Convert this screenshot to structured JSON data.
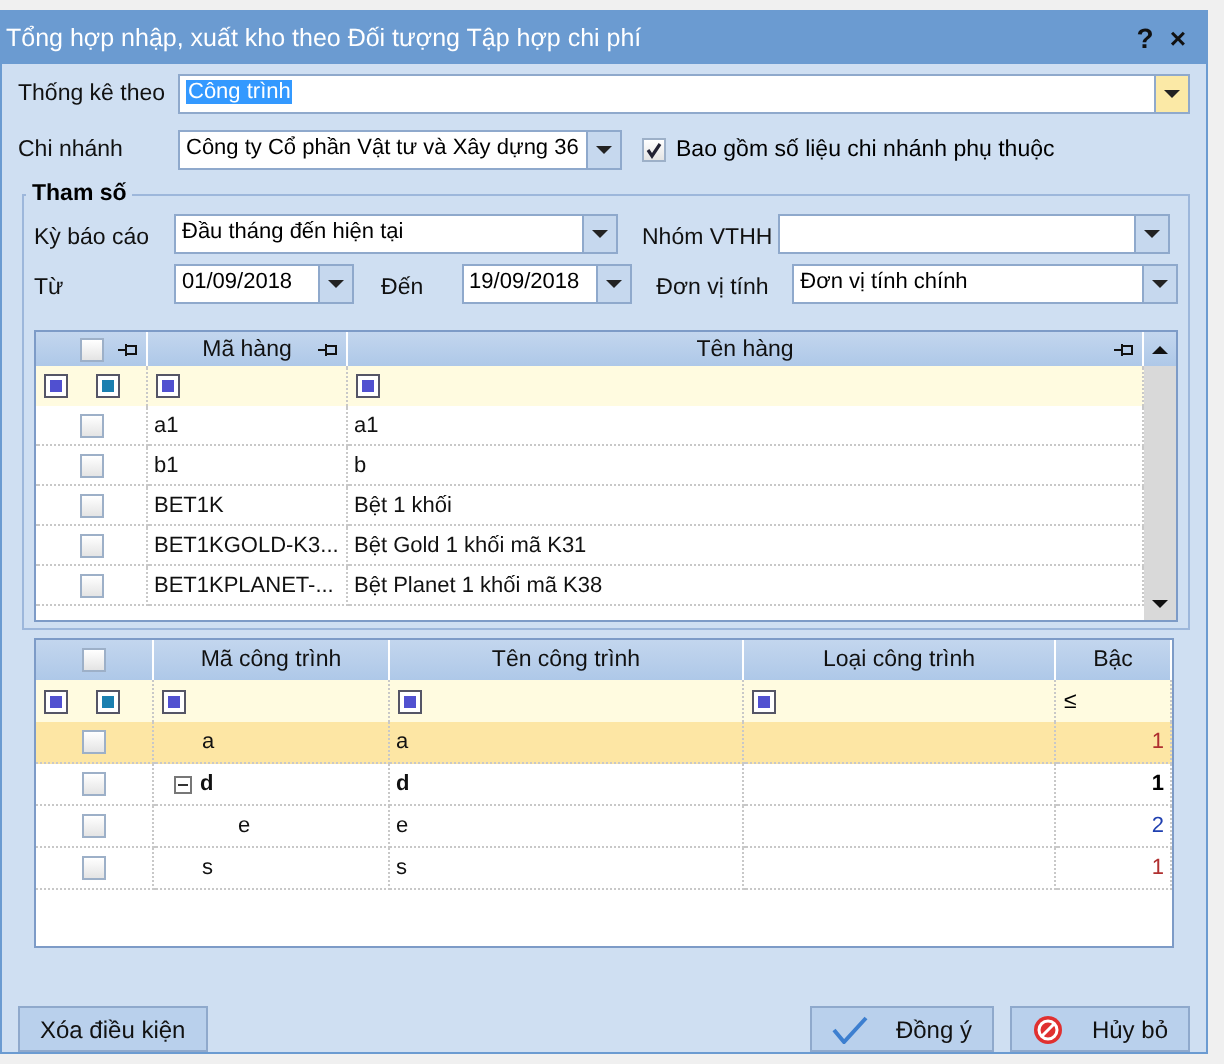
{
  "window": {
    "title": "Tổng hợp nhập, xuất kho theo Đối tượng Tập hợp chi phí",
    "help": "?",
    "close": "×"
  },
  "stat_by": {
    "label": "Thống kê theo",
    "value": "Công trình"
  },
  "branch": {
    "label": "Chi nhánh",
    "value": "Công ty Cổ phần Vật tư và Xây dựng 36",
    "include_dependent": {
      "label": "Bao gồm số liệu chi nhánh phụ thuộc",
      "checked": true
    }
  },
  "params": {
    "title": "Tham số",
    "period": {
      "label": "Kỳ báo cáo",
      "value": "Đầu tháng đến hiện tại"
    },
    "group": {
      "label": "Nhóm VTHH"
    },
    "from": {
      "label": "Từ",
      "value": "01/09/2018"
    },
    "to": {
      "label": "Đến",
      "value": "19/09/2018"
    },
    "unit": {
      "label": "Đơn vị tính",
      "value": "Đơn vị tính chính"
    }
  },
  "items_grid": {
    "all_checked": false,
    "columns": [
      "Mã hàng",
      "Tên hàng"
    ],
    "rows": [
      {
        "code": "a1",
        "name": "a1",
        "checked": false
      },
      {
        "code": "b1",
        "name": "b",
        "checked": false
      },
      {
        "code": "BET1K",
        "name": "Bệt 1 khối",
        "checked": false
      },
      {
        "code": "BET1KGOLD-K3...",
        "name": "Bệt Gold 1 khối mã K31",
        "checked": false
      },
      {
        "code": "BET1KPLANET-...",
        "name": "Bệt Planet 1 khối mã K38",
        "checked": false
      }
    ]
  },
  "works_grid": {
    "all_checked": false,
    "columns": [
      "Mã công trình",
      "Tên công trình",
      "Loại công trình",
      "Bậc"
    ],
    "level_filter": "≤",
    "rows": [
      {
        "code": "a",
        "name": "a",
        "level": "1",
        "color": "#b03030",
        "checked": false,
        "selected": true
      },
      {
        "code": "d",
        "name": "d",
        "level": "1",
        "color": "#000000",
        "checked": false,
        "selected": false,
        "expanded": true,
        "children": [
          {
            "code": "e",
            "name": "e",
            "level": "2",
            "color": "#2040b0",
            "checked": false,
            "selected": false
          }
        ]
      },
      {
        "code": "s",
        "name": "s",
        "level": "1",
        "color": "#b03030",
        "checked": false,
        "selected": false
      }
    ]
  },
  "buttons": {
    "clear": "Xóa điều kiện",
    "ok": "Đồng ý",
    "cancel": "Hủy bỏ"
  }
}
